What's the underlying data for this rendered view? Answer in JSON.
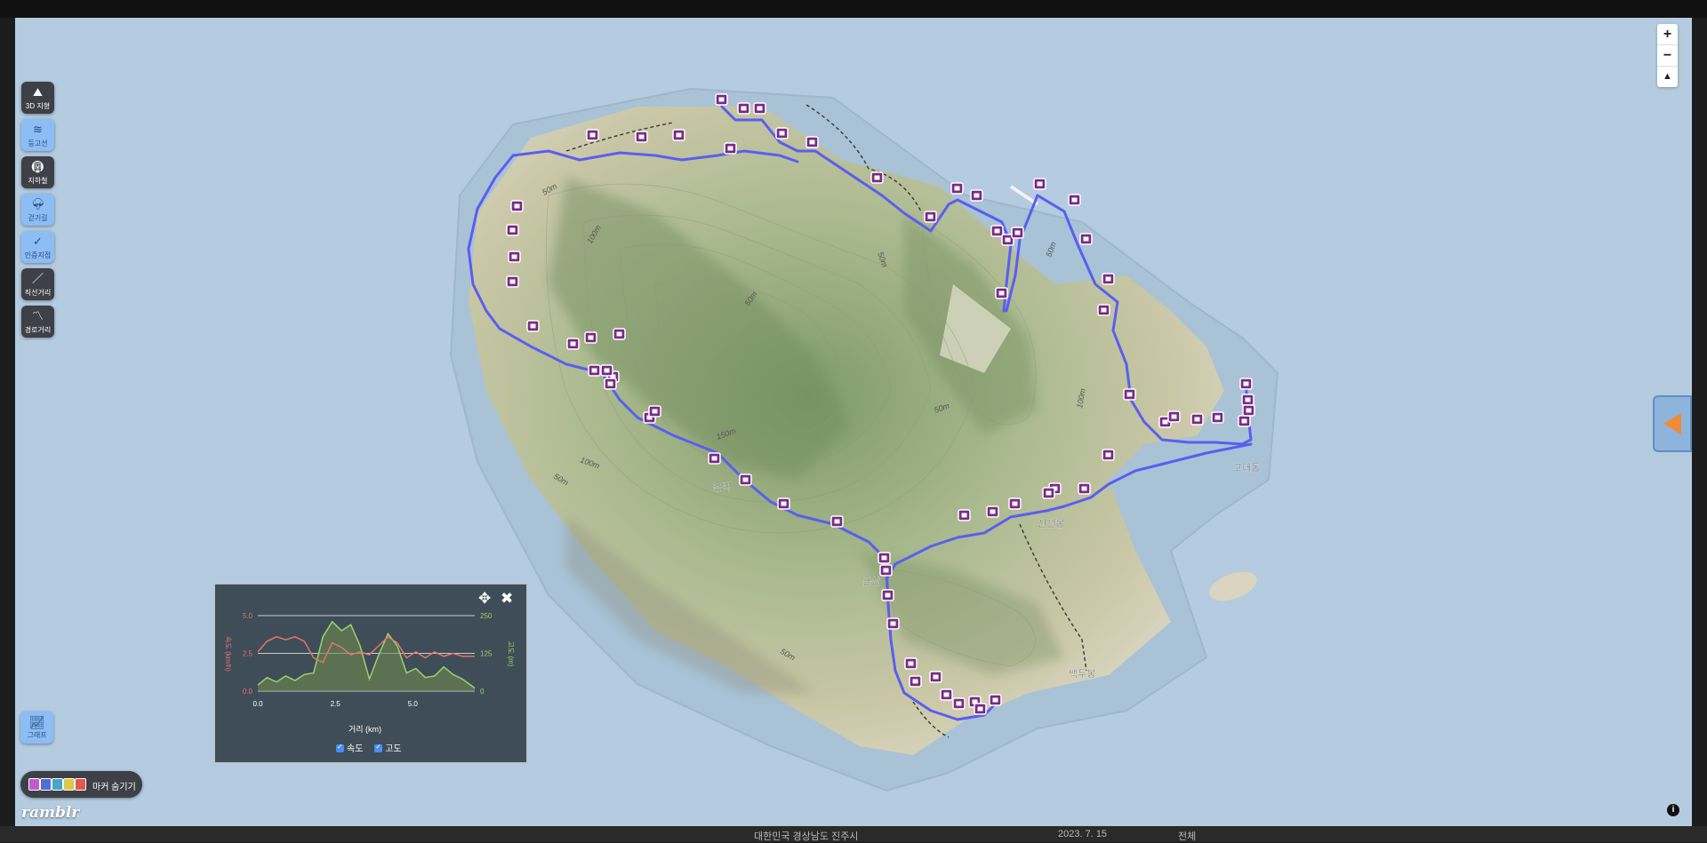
{
  "toolbar": {
    "items": [
      {
        "label": "3D 지형",
        "icon": "terrain-3d-icon",
        "active": false
      },
      {
        "label": "등고선",
        "icon": "contour-icon",
        "active": true
      },
      {
        "label": "지하철",
        "icon": "subway-icon",
        "active": false
      },
      {
        "label": "걷기길",
        "icon": "trail-icon",
        "active": true
      },
      {
        "label": "인증지점",
        "icon": "certified-point-icon",
        "active": true
      },
      {
        "label": "직선거리",
        "icon": "straight-distance-icon",
        "active": false
      },
      {
        "label": "경로거리",
        "icon": "route-distance-icon",
        "active": false
      }
    ],
    "graph_label": "그래프"
  },
  "zoom": {
    "in": "+",
    "out": "−",
    "north": "▲"
  },
  "map_labels": {
    "contours": [
      "50m",
      "100m",
      "150m",
      "50m",
      "100m",
      "50m",
      "50m",
      "50m",
      "100m",
      "50m",
      "100m",
      "50m"
    ],
    "places": [
      "은벽",
      "금산",
      "신선봉",
      "고대동",
      "백두봉"
    ]
  },
  "graph": {
    "y_left_label": "속도 (km/h)",
    "y_right_label": "고도 (m)",
    "x_label": "거리 (km)",
    "y_left_ticks": [
      "5.0",
      "2.5",
      "0.0"
    ],
    "y_right_ticks": [
      "250",
      "125",
      "0"
    ],
    "x_ticks": [
      "0.0",
      "2.5",
      "5.0"
    ],
    "legend": [
      {
        "label": "속도"
      },
      {
        "label": "고도"
      }
    ],
    "colors": {
      "speed": "#e9736b",
      "elevation": "#9ad36b",
      "elevation_fill": "#6e8a4f"
    }
  },
  "chart_data": {
    "type": "line",
    "xlabel": "거리 (km)",
    "ylabel": "속도 (km/h)",
    "y2label": "고도 (m)",
    "xlim": [
      0,
      7
    ],
    "ylim": [
      0,
      5
    ],
    "y2lim": [
      0,
      250
    ],
    "series": [
      {
        "name": "속도",
        "axis": "left",
        "x": [
          0,
          0.3,
          0.6,
          0.9,
          1.2,
          1.5,
          1.8,
          2.1,
          2.4,
          2.7,
          3.0,
          3.3,
          3.6,
          3.9,
          4.2,
          4.5,
          4.8,
          5.1,
          5.4,
          5.7,
          6.0,
          6.3,
          6.6,
          7.0
        ],
        "values": [
          2.6,
          3.3,
          3.6,
          3.4,
          3.6,
          3.3,
          2.2,
          1.9,
          3.2,
          2.9,
          2.4,
          2.6,
          2.4,
          3.0,
          3.6,
          3.2,
          2.2,
          2.6,
          2.2,
          2.6,
          2.3,
          2.5,
          2.3,
          2.3
        ]
      },
      {
        "name": "고도",
        "axis": "right",
        "x": [
          0,
          0.3,
          0.6,
          0.9,
          1.2,
          1.5,
          1.8,
          2.1,
          2.4,
          2.7,
          3.0,
          3.3,
          3.6,
          3.9,
          4.2,
          4.5,
          4.8,
          5.1,
          5.4,
          5.7,
          6.0,
          6.3,
          6.6,
          7.0
        ],
        "values": [
          20,
          45,
          30,
          50,
          35,
          55,
          60,
          180,
          230,
          200,
          220,
          150,
          40,
          120,
          190,
          150,
          60,
          75,
          45,
          50,
          80,
          55,
          40,
          10
        ]
      }
    ]
  },
  "marker_toggle": {
    "label": "마커 숨기기",
    "colors": [
      "#c05bc9",
      "#4f6fd6",
      "#4aa3c9",
      "#d9c84a",
      "#e0584f"
    ]
  },
  "logo": "ramblr",
  "info": "i",
  "bottombar": {
    "address": "대한민국 경상남도 진주시",
    "date": "2023. 7. 15",
    "extra": "전체"
  }
}
